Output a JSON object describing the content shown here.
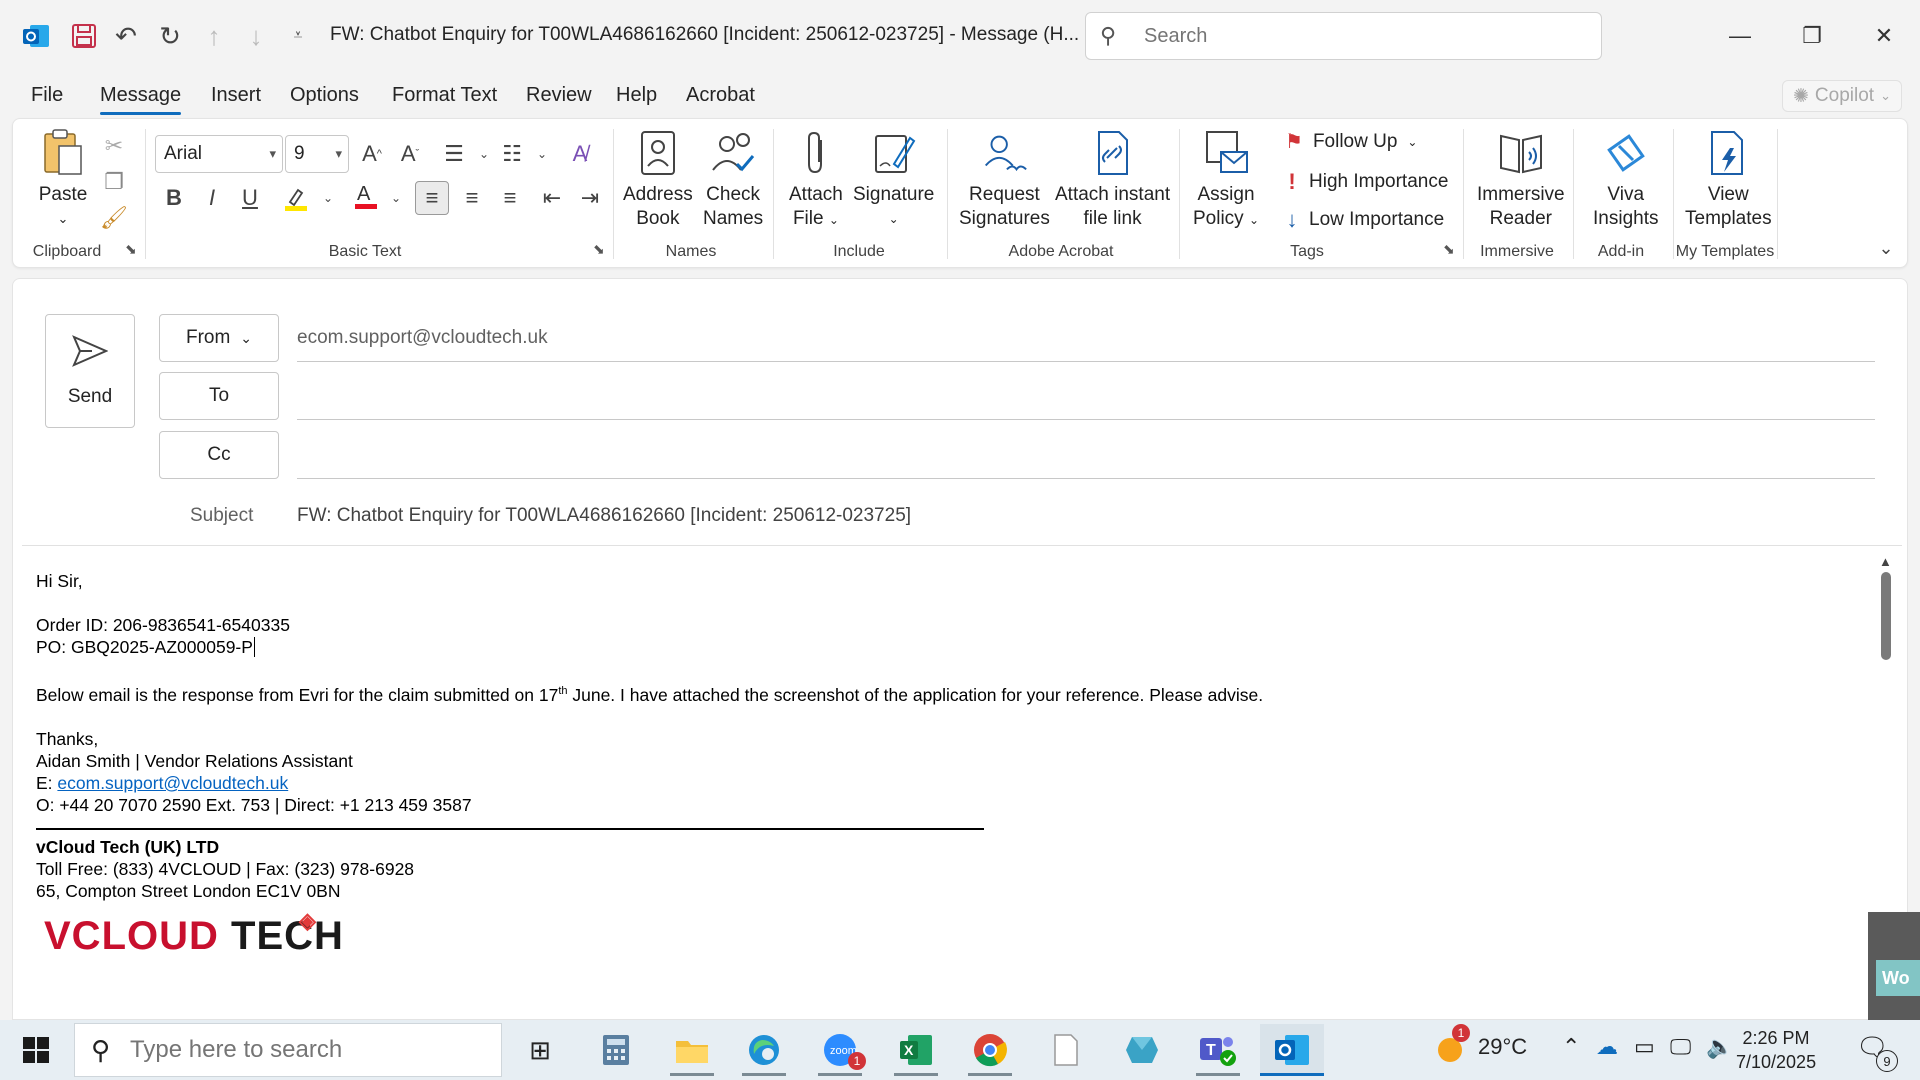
{
  "titlebar": {
    "app_icon": "outlook-icon",
    "title": "FW: Chatbot Enquiry for T00WLA4686162660 [Incident: 250612-023725]  -  Message (H...",
    "search_placeholder": "Search"
  },
  "menu": {
    "tabs": [
      "File",
      "Message",
      "Insert",
      "Options",
      "Format Text",
      "Review",
      "Help",
      "Acrobat"
    ],
    "active": "Message",
    "copilot_label": "Copilot"
  },
  "ribbon": {
    "clipboard": {
      "paste_label": "Paste",
      "group_label": "Clipboard"
    },
    "basic_text": {
      "font_name": "Arial",
      "font_size": "9",
      "group_label": "Basic Text"
    },
    "names": {
      "address_book_line1": "Address",
      "address_book_line2": "Book",
      "check_names_line1": "Check",
      "check_names_line2": "Names",
      "group_label": "Names"
    },
    "include": {
      "attach_file_line1": "Attach",
      "attach_file_line2": "File",
      "signature_label": "Signature",
      "group_label": "Include"
    },
    "adobe": {
      "request_sig_line1": "Request",
      "request_sig_line2": "Signatures",
      "attach_link_line1": "Attach instant",
      "attach_link_line2": "file link",
      "group_label": "Adobe Acrobat"
    },
    "tags": {
      "assign_policy_line1": "Assign",
      "assign_policy_line2": "Policy",
      "follow_up": "Follow Up",
      "high_importance": "High Importance",
      "low_importance": "Low Importance",
      "group_label": "Tags"
    },
    "immersive": {
      "reader_line1": "Immersive",
      "reader_line2": "Reader",
      "group_label": "Immersive"
    },
    "addin": {
      "viva_line1": "Viva",
      "viva_line2": "Insights",
      "group_label": "Add-in"
    },
    "templates": {
      "view_line1": "View",
      "view_line2": "Templates",
      "group_label": "My Templates"
    }
  },
  "compose": {
    "send_label": "Send",
    "from_label": "From",
    "from_value": "ecom.support@vcloudtech.uk",
    "to_label": "To",
    "cc_label": "Cc",
    "subject_label": "Subject",
    "subject_value": "FW: Chatbot Enquiry for T00WLA4686162660 [Incident: 250612-023725]"
  },
  "body": {
    "greeting": "Hi Sir,",
    "order_id": "Order ID: 206-9836541-6540335",
    "po": "PO: GBQ2025-AZ000059-P",
    "message_pre": "Below email is the response from Evri for the claim submitted on 17",
    "message_sup": "th",
    "message_post": " June. I have attached the screenshot of the application for your reference.  Please advise.",
    "thanks": "Thanks,",
    "sender_line": "Aidan Smith | Vendor Relations Assistant",
    "email_prefix": "E: ",
    "email_link": "ecom.support@vcloudtech.uk",
    "phone_line": "O:  +44 20 7070 2590 Ext. 753 | Direct: +1 213 459 3587",
    "company": "vCloud Tech (UK) LTD",
    "tollfree": "Toll Free: (833) 4VCLOUD | Fax: (323) 978-6928",
    "address": "65, Compton Street London EC1V 0BN",
    "logo_part1": "VCLOUD",
    "logo_part2": " TECH"
  },
  "side_sliver": {
    "text": "Wo"
  },
  "taskbar": {
    "search_placeholder": "Type here to search",
    "zoom_badge": "1",
    "weather_badge": "1",
    "temperature": "29°C",
    "time": "2:26 PM",
    "date": "7/10/2025",
    "notification_count": "9"
  }
}
